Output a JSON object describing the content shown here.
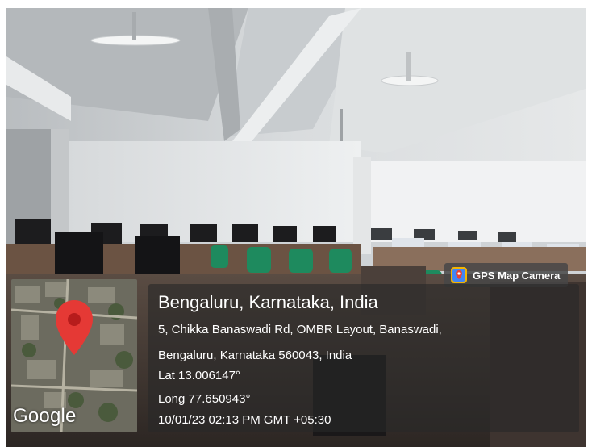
{
  "badge": {
    "app_name": "GPS Map Camera",
    "icon": "gps-map-camera-app-icon"
  },
  "map": {
    "logo_text": "Google",
    "icon": "map-location-pin-icon"
  },
  "location": {
    "title": "Bengaluru, Karnataka, India",
    "address_line1": "5, Chikka Banaswadi Rd, OMBR Layout, Banaswadi,",
    "address_line2": "Bengaluru, Karnataka 560043, India",
    "latitude": "Lat 13.006147°",
    "longitude": "Long 77.650943°",
    "timestamp": "10/01/23 02:13 PM GMT +05:30"
  },
  "colors": {
    "pin": "#e53935",
    "overlay": "#282828",
    "chair": "#1e8a5e"
  }
}
